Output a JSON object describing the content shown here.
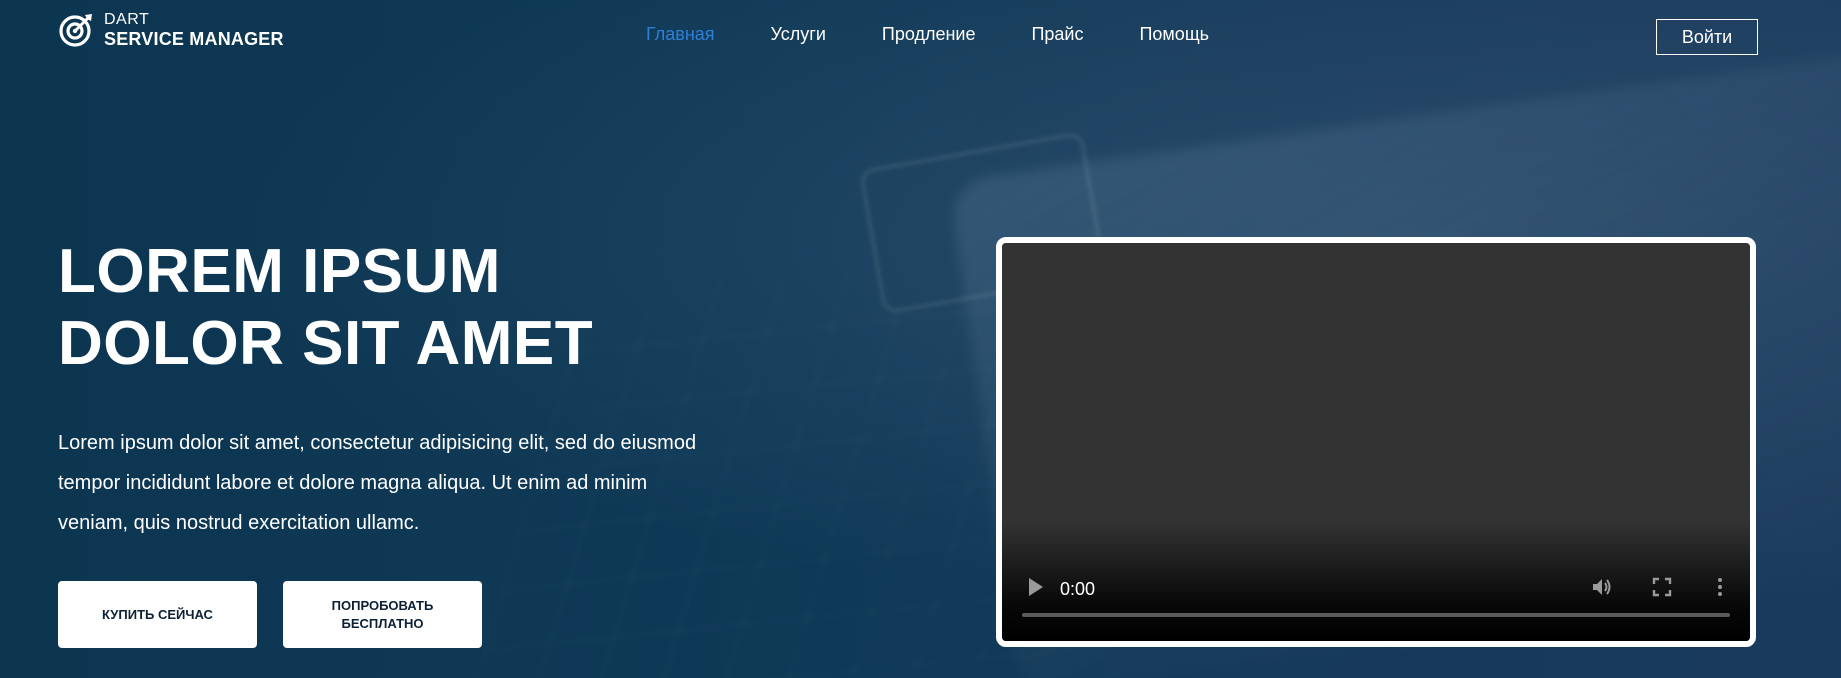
{
  "brand": {
    "line1": "DART",
    "line2": "SERVICE MANAGER"
  },
  "nav": {
    "items": [
      {
        "label": "Главная",
        "active": true
      },
      {
        "label": "Услуги",
        "active": false
      },
      {
        "label": "Продление",
        "active": false
      },
      {
        "label": "Прайс",
        "active": false
      },
      {
        "label": "Помощь",
        "active": false
      }
    ],
    "active_color": "#2f7fd6"
  },
  "header": {
    "login_label": "Войти"
  },
  "hero": {
    "title_line1": "LOREM IPSUM",
    "title_line2": "DOLOR SIT AMET",
    "text": "Lorem ipsum dolor sit amet, consectetur adipisicing elit, sed do eiusmod tempor incididunt labore et dolore magna aliqua. Ut enim ad minim veniam, quis nostrud exercitation ullamc.",
    "buy_label": "КУПИТЬ СЕЙЧАС",
    "try_label": "ПОПРОБОВАТЬ БЕСПЛАТНО"
  },
  "video": {
    "time": "0:00",
    "progress": 0,
    "icons": {
      "play": "play-icon",
      "mute": "volume-icon",
      "fullscreen": "fullscreen-icon",
      "more": "more-vertical-icon"
    }
  },
  "colors": {
    "background": "#0f3550",
    "button_text": "#0d2035"
  }
}
